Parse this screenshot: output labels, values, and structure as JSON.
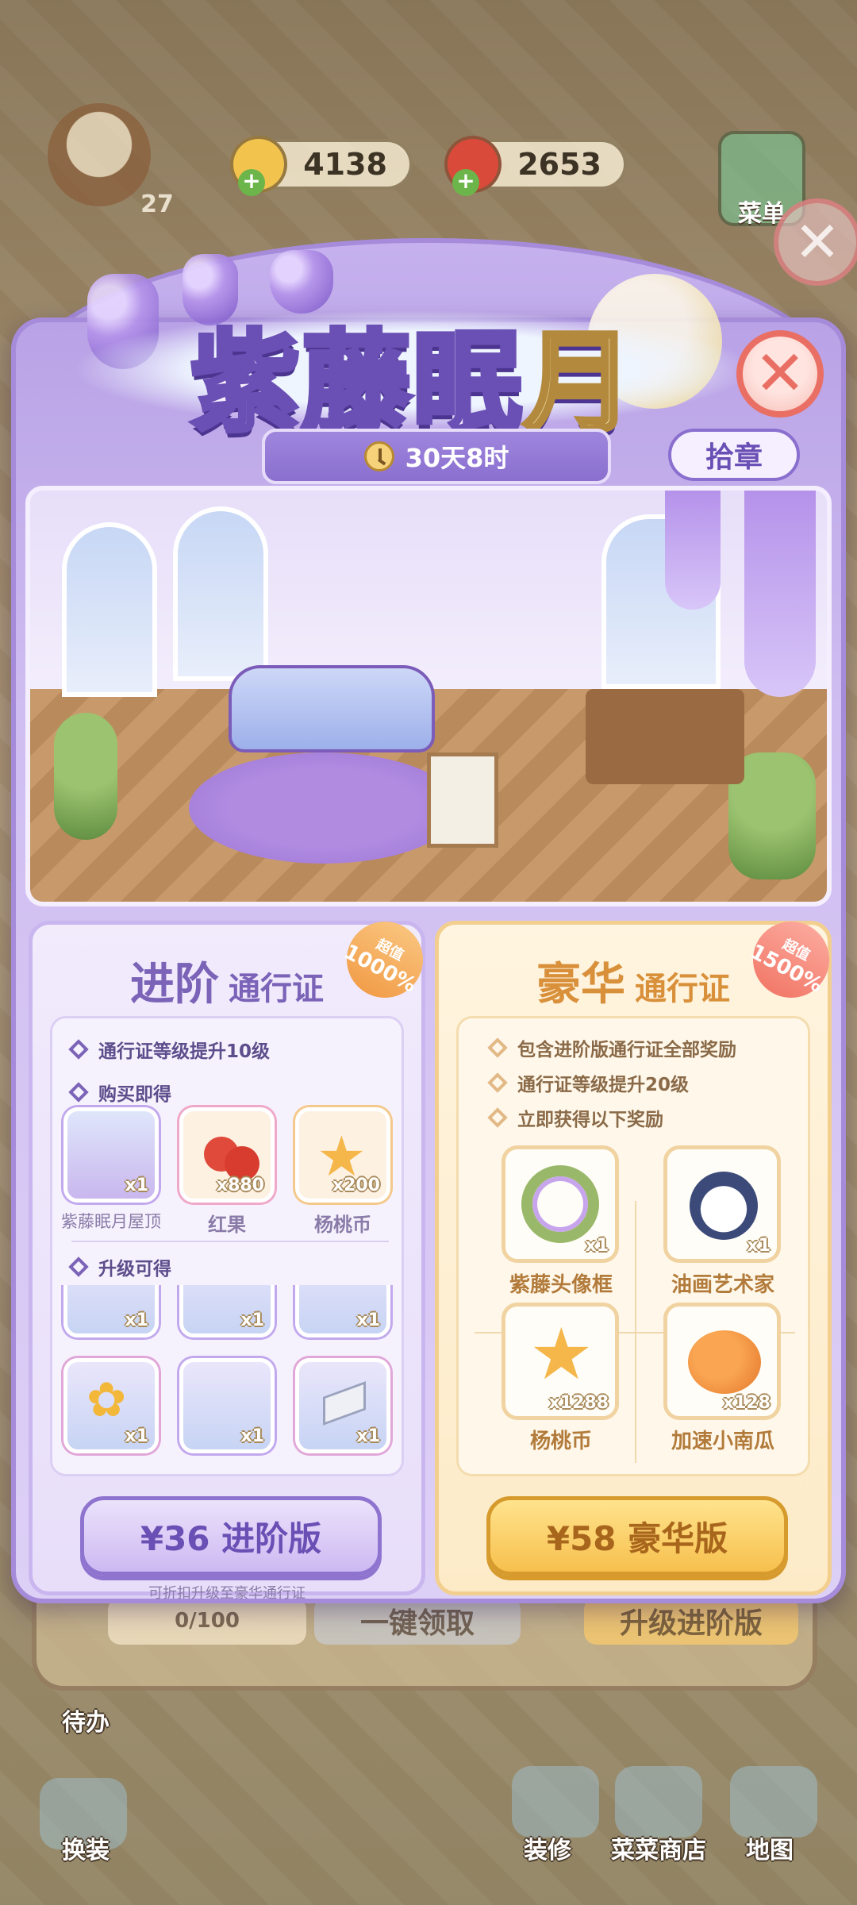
{
  "background": {
    "resources": [
      {
        "name": "coin",
        "value": "4138",
        "color": "#f2c34d"
      },
      {
        "name": "apple",
        "value": "2653",
        "color": "#d94a3a"
      }
    ],
    "player_level": "27",
    "menu_label": "菜单",
    "behind_progress": "0/100",
    "behind_buttons": [
      "一键领取",
      "升级进阶版"
    ],
    "bottom_nav": [
      "待办",
      "换装",
      "装修",
      "菜菜商店",
      "地图"
    ]
  },
  "event": {
    "title_main": "紫藤眠",
    "title_moon": "月",
    "timer": "30天8时",
    "badge_button": "拾章"
  },
  "advanced_pass": {
    "title_big": "进阶",
    "title_small": "通行证",
    "value_tag_top": "超值",
    "value_tag_bottom": "1000%",
    "bullet_level": "通行证等级提升10级",
    "section_buy": "购买即得",
    "instant_items": [
      {
        "name": "紫藤眠月屋顶",
        "qty": "x1",
        "icon": "roof-icon"
      },
      {
        "name": "红果",
        "qty": "x880",
        "icon": "red-fruit-icon"
      },
      {
        "name": "杨桃币",
        "qty": "x200",
        "icon": "starfruit-coin-icon"
      }
    ],
    "section_upgrade": "升级可得",
    "upgrade_items_row1": [
      {
        "qty": "x1",
        "icon": "easel-icon"
      },
      {
        "qty": "x1",
        "icon": "painting-icon"
      },
      {
        "qty": "x1",
        "icon": "table-icon"
      }
    ],
    "upgrade_items_row2": [
      {
        "qty": "x1",
        "icon": "sunflower-vase-icon"
      },
      {
        "qty": "x1",
        "icon": "art-supplies-icon"
      },
      {
        "qty": "x1",
        "icon": "corner-tile-icon"
      }
    ],
    "buy_label": "¥36 进阶版",
    "note": "可折扣升级至豪华通行证"
  },
  "luxury_pass": {
    "title_big": "豪华",
    "title_small": "通行证",
    "value_tag_top": "超值",
    "value_tag_bottom": "1500%",
    "bullets": [
      "包含进阶版通行证全部奖励",
      "通行证等级提升20级",
      "立即获得以下奖励"
    ],
    "rewards": [
      {
        "name": "紫藤头像框",
        "qty": "x1",
        "icon": "wisteria-frame-icon"
      },
      {
        "name": "油画艺术家",
        "qty": "x1",
        "icon": "painter-bird-icon"
      },
      {
        "name": "杨桃币",
        "qty": "x1288",
        "icon": "starfruit-coin-icon"
      },
      {
        "name": "加速小南瓜",
        "qty": "x128",
        "icon": "pumpkin-icon"
      }
    ],
    "buy_label": "¥58 豪华版"
  },
  "close_icon": "close-icon"
}
